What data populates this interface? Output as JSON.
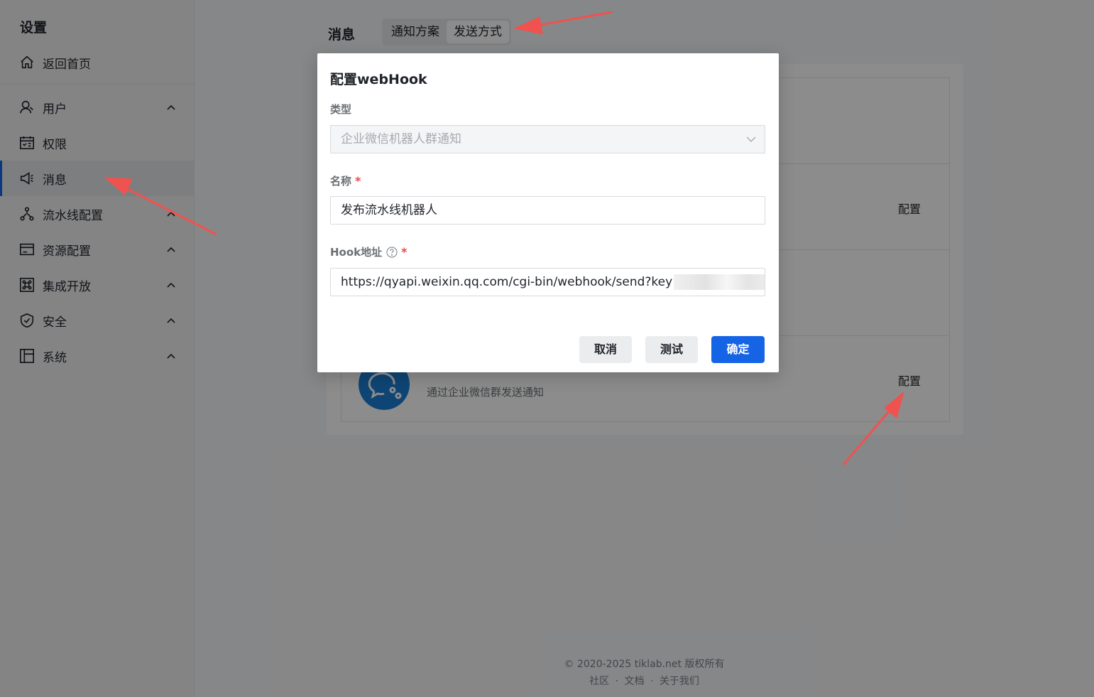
{
  "sidebar": {
    "title": "设置",
    "home": "返回首页",
    "items": [
      {
        "label": "用户"
      },
      {
        "label": "权限"
      },
      {
        "label": "消息"
      },
      {
        "label": "流水线配置"
      },
      {
        "label": "资源配置"
      },
      {
        "label": "集成开放"
      },
      {
        "label": "安全"
      },
      {
        "label": "系统"
      }
    ]
  },
  "main": {
    "title": "消息",
    "tabs": [
      {
        "label": "通知方案"
      },
      {
        "label": "发送方式"
      }
    ],
    "cards": [
      {
        "config_label": "配置"
      },
      {
        "config_label": "配置",
        "desc": "通过企业微信群发送通知"
      }
    ]
  },
  "footer": {
    "copyright": "© 2020-2025 tiklab.net 版权所有",
    "links": [
      "社区",
      "文档",
      "关于我们"
    ],
    "separator": "·"
  },
  "modal": {
    "title": "配置webHook",
    "type_label": "类型",
    "type_value": "企业微信机器人群通知",
    "name_label": "名称",
    "name_value": "发布流水线机器人",
    "hook_label": "Hook地址",
    "hook_value": "https://qyapi.weixin.qq.com/cgi-bin/webhook/send?key",
    "required_mark": "*",
    "cancel": "取消",
    "test": "测试",
    "confirm": "确定"
  },
  "colors": {
    "primary": "#1664e6",
    "required": "#e5484d",
    "annotation_arrow": "#f0524f"
  }
}
